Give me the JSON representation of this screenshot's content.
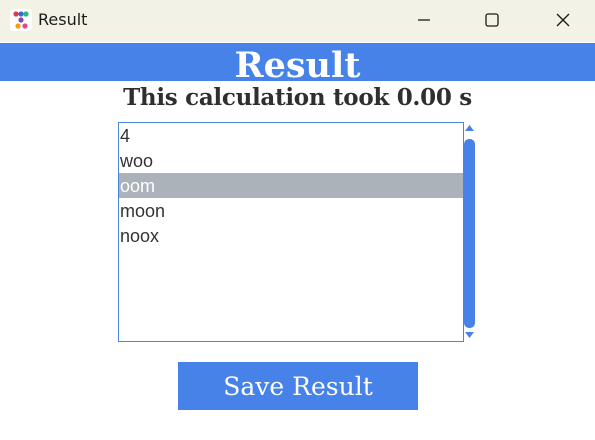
{
  "window": {
    "title": "Result",
    "icon": "app-dots-icon",
    "controls": [
      "minimize-icon",
      "maximize-icon",
      "close-icon"
    ]
  },
  "header": {
    "title": "Result"
  },
  "subtitle": "This calculation took 0.00 s",
  "results": {
    "items": [
      {
        "label": "4"
      },
      {
        "label": "woo"
      },
      {
        "label": "oom",
        "selected": true
      },
      {
        "label": "moon"
      },
      {
        "label": "noox"
      }
    ]
  },
  "actions": {
    "save_label": "Save Result"
  },
  "colors": {
    "accent": "#4682e8",
    "titlebar": "#f3f2e7",
    "selection": "#abb2b9",
    "text": "#2f2f2f"
  }
}
